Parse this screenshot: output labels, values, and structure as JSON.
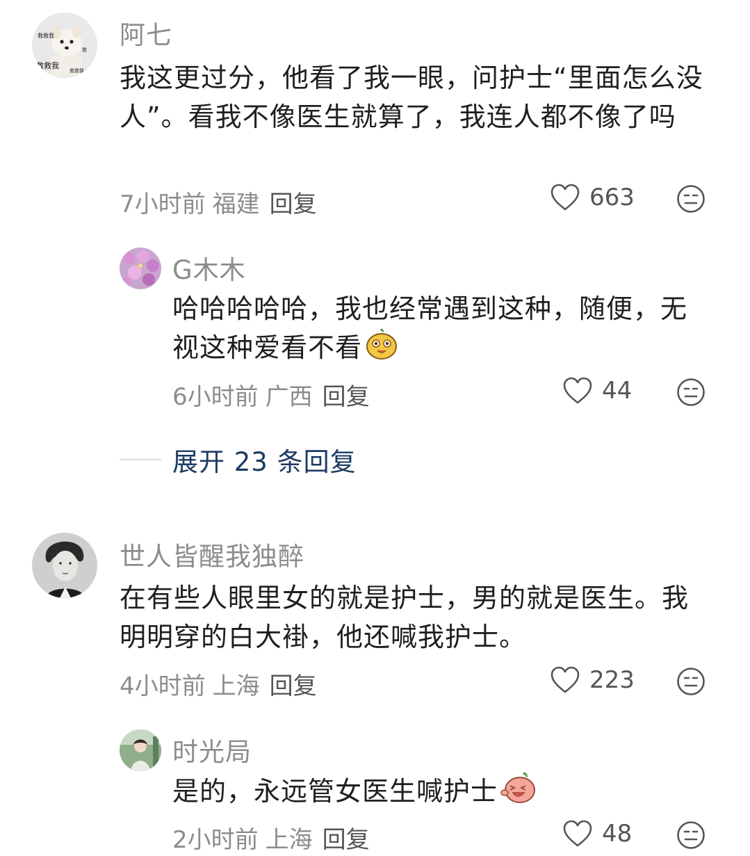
{
  "comments": [
    {
      "username": "阿七",
      "text": "我这更过分，他看了我一眼，问护士“里面怎么没人”。看我不像医生就算了，我连人都不像了吗",
      "time": "7小时前",
      "location": "福建",
      "reply_label": "回复",
      "likes": "663",
      "avatar": "dog-avatar",
      "replies": [
        {
          "username": "G木木",
          "text": "哈哈哈哈哈，我也经常遇到这种，随便，无视这种爱看不看",
          "time": "6小时前",
          "location": "广西",
          "reply_label": "回复",
          "likes": "44",
          "avatar": "flower-avatar",
          "emoji": "smile-sticker-icon"
        }
      ],
      "expand_label": "展开 23 条回复"
    },
    {
      "username": "世人皆醒我独醉",
      "text": "在有些人眼里女的就是护士，男的就是医生。我明明穿的白大褂，他还喊我护士。",
      "time": "4小时前",
      "location": "上海",
      "reply_label": "回复",
      "likes": "223",
      "avatar": "portrait-avatar",
      "replies": [
        {
          "username": "时光局",
          "text": "是的，永远管女医生喊护士",
          "time": "2小时前",
          "location": "上海",
          "reply_label": "回复",
          "likes": "48",
          "avatar": "photo-avatar",
          "emoji": "laughing-sticker-icon"
        }
      ]
    }
  ]
}
